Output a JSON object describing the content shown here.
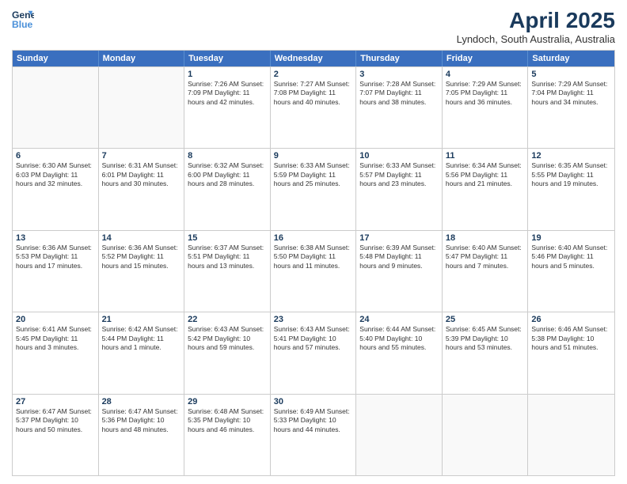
{
  "header": {
    "logo_line1": "General",
    "logo_line2": "Blue",
    "month": "April 2025",
    "location": "Lyndoch, South Australia, Australia"
  },
  "weekdays": [
    "Sunday",
    "Monday",
    "Tuesday",
    "Wednesday",
    "Thursday",
    "Friday",
    "Saturday"
  ],
  "weeks": [
    [
      {
        "day": "",
        "info": ""
      },
      {
        "day": "",
        "info": ""
      },
      {
        "day": "1",
        "info": "Sunrise: 7:26 AM\nSunset: 7:09 PM\nDaylight: 11 hours and 42 minutes."
      },
      {
        "day": "2",
        "info": "Sunrise: 7:27 AM\nSunset: 7:08 PM\nDaylight: 11 hours and 40 minutes."
      },
      {
        "day": "3",
        "info": "Sunrise: 7:28 AM\nSunset: 7:07 PM\nDaylight: 11 hours and 38 minutes."
      },
      {
        "day": "4",
        "info": "Sunrise: 7:29 AM\nSunset: 7:05 PM\nDaylight: 11 hours and 36 minutes."
      },
      {
        "day": "5",
        "info": "Sunrise: 7:29 AM\nSunset: 7:04 PM\nDaylight: 11 hours and 34 minutes."
      }
    ],
    [
      {
        "day": "6",
        "info": "Sunrise: 6:30 AM\nSunset: 6:03 PM\nDaylight: 11 hours and 32 minutes."
      },
      {
        "day": "7",
        "info": "Sunrise: 6:31 AM\nSunset: 6:01 PM\nDaylight: 11 hours and 30 minutes."
      },
      {
        "day": "8",
        "info": "Sunrise: 6:32 AM\nSunset: 6:00 PM\nDaylight: 11 hours and 28 minutes."
      },
      {
        "day": "9",
        "info": "Sunrise: 6:33 AM\nSunset: 5:59 PM\nDaylight: 11 hours and 25 minutes."
      },
      {
        "day": "10",
        "info": "Sunrise: 6:33 AM\nSunset: 5:57 PM\nDaylight: 11 hours and 23 minutes."
      },
      {
        "day": "11",
        "info": "Sunrise: 6:34 AM\nSunset: 5:56 PM\nDaylight: 11 hours and 21 minutes."
      },
      {
        "day": "12",
        "info": "Sunrise: 6:35 AM\nSunset: 5:55 PM\nDaylight: 11 hours and 19 minutes."
      }
    ],
    [
      {
        "day": "13",
        "info": "Sunrise: 6:36 AM\nSunset: 5:53 PM\nDaylight: 11 hours and 17 minutes."
      },
      {
        "day": "14",
        "info": "Sunrise: 6:36 AM\nSunset: 5:52 PM\nDaylight: 11 hours and 15 minutes."
      },
      {
        "day": "15",
        "info": "Sunrise: 6:37 AM\nSunset: 5:51 PM\nDaylight: 11 hours and 13 minutes."
      },
      {
        "day": "16",
        "info": "Sunrise: 6:38 AM\nSunset: 5:50 PM\nDaylight: 11 hours and 11 minutes."
      },
      {
        "day": "17",
        "info": "Sunrise: 6:39 AM\nSunset: 5:48 PM\nDaylight: 11 hours and 9 minutes."
      },
      {
        "day": "18",
        "info": "Sunrise: 6:40 AM\nSunset: 5:47 PM\nDaylight: 11 hours and 7 minutes."
      },
      {
        "day": "19",
        "info": "Sunrise: 6:40 AM\nSunset: 5:46 PM\nDaylight: 11 hours and 5 minutes."
      }
    ],
    [
      {
        "day": "20",
        "info": "Sunrise: 6:41 AM\nSunset: 5:45 PM\nDaylight: 11 hours and 3 minutes."
      },
      {
        "day": "21",
        "info": "Sunrise: 6:42 AM\nSunset: 5:44 PM\nDaylight: 11 hours and 1 minute."
      },
      {
        "day": "22",
        "info": "Sunrise: 6:43 AM\nSunset: 5:42 PM\nDaylight: 10 hours and 59 minutes."
      },
      {
        "day": "23",
        "info": "Sunrise: 6:43 AM\nSunset: 5:41 PM\nDaylight: 10 hours and 57 minutes."
      },
      {
        "day": "24",
        "info": "Sunrise: 6:44 AM\nSunset: 5:40 PM\nDaylight: 10 hours and 55 minutes."
      },
      {
        "day": "25",
        "info": "Sunrise: 6:45 AM\nSunset: 5:39 PM\nDaylight: 10 hours and 53 minutes."
      },
      {
        "day": "26",
        "info": "Sunrise: 6:46 AM\nSunset: 5:38 PM\nDaylight: 10 hours and 51 minutes."
      }
    ],
    [
      {
        "day": "27",
        "info": "Sunrise: 6:47 AM\nSunset: 5:37 PM\nDaylight: 10 hours and 50 minutes."
      },
      {
        "day": "28",
        "info": "Sunrise: 6:47 AM\nSunset: 5:36 PM\nDaylight: 10 hours and 48 minutes."
      },
      {
        "day": "29",
        "info": "Sunrise: 6:48 AM\nSunset: 5:35 PM\nDaylight: 10 hours and 46 minutes."
      },
      {
        "day": "30",
        "info": "Sunrise: 6:49 AM\nSunset: 5:33 PM\nDaylight: 10 hours and 44 minutes."
      },
      {
        "day": "",
        "info": ""
      },
      {
        "day": "",
        "info": ""
      },
      {
        "day": "",
        "info": ""
      }
    ]
  ]
}
